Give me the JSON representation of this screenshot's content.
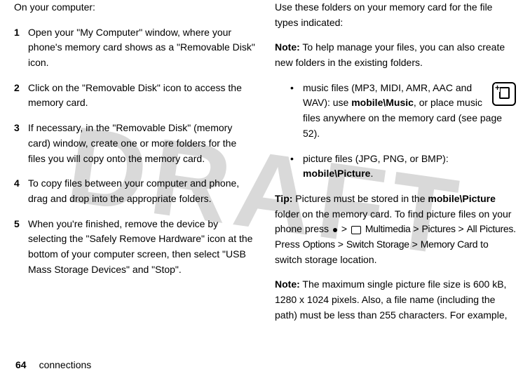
{
  "watermark": "DRAFT",
  "left": {
    "intro": "On your computer:",
    "steps": [
      {
        "num": "1",
        "text": "Open your \"My Computer\" window, where your phone's memory card shows as a \"Removable Disk\" icon."
      },
      {
        "num": "2",
        "text": "Click on the \"Removable Disk\" icon to access the memory card."
      },
      {
        "num": "3",
        "text": "If necessary, in the \"Removable Disk\" (memory card) window, create one or more folders for the files you will copy onto the memory card."
      },
      {
        "num": "4",
        "text": "To copy files between your computer and phone, drag and drop into the appropriate folders."
      },
      {
        "num": "5",
        "text": "When you're finished, remove the device by selecting the \"Safely Remove Hardware\" icon at the bottom of your computer screen, then select \"USB Mass Storage Devices\" and \"Stop\"."
      }
    ]
  },
  "right": {
    "intro": "Use these folders on your memory card for the file types indicated:",
    "note1_label": "Note:",
    "note1_text": " To help manage your files, you can also create new folders in the existing folders.",
    "bullet1_pre": "music files (MP3, MIDI, AMR, AAC and WAV): use ",
    "bullet1_bold": "mobile\\Music",
    "bullet1_post": ", or place music files anywhere on the memory card (see page 52).",
    "bullet2_pre": "picture files (JPG, PNG, or BMP): ",
    "bullet2_bold": "mobile\\Picture",
    "bullet2_post": ".",
    "tip_label": "Tip:",
    "tip_pre": " Pictures must be stored in the ",
    "tip_bold1": "mobile\\Picture",
    "tip_mid1": " folder on the memory card. To find picture files on your phone press ",
    "tip_gt1": " > ",
    "tip_mm": "Multimedia",
    "tip_gt2": " > ",
    "tip_pics": "Pictures",
    "tip_gt3": " > ",
    "tip_all": "All Pictures",
    "tip_press": ". Press ",
    "tip_opt": "Options",
    "tip_gt4": " > ",
    "tip_switch": "Switch Storage",
    "tip_gt5": " > ",
    "tip_mem": "Memory Card",
    "tip_end": " to switch storage location.",
    "note2_label": "Note:",
    "note2_text": " The maximum single picture file size is 600 kB, 1280 x 1024 pixels. Also, a file name (including the path) must be less than 255 characters. For example,"
  },
  "footer": {
    "page": "64",
    "section": "connections"
  }
}
